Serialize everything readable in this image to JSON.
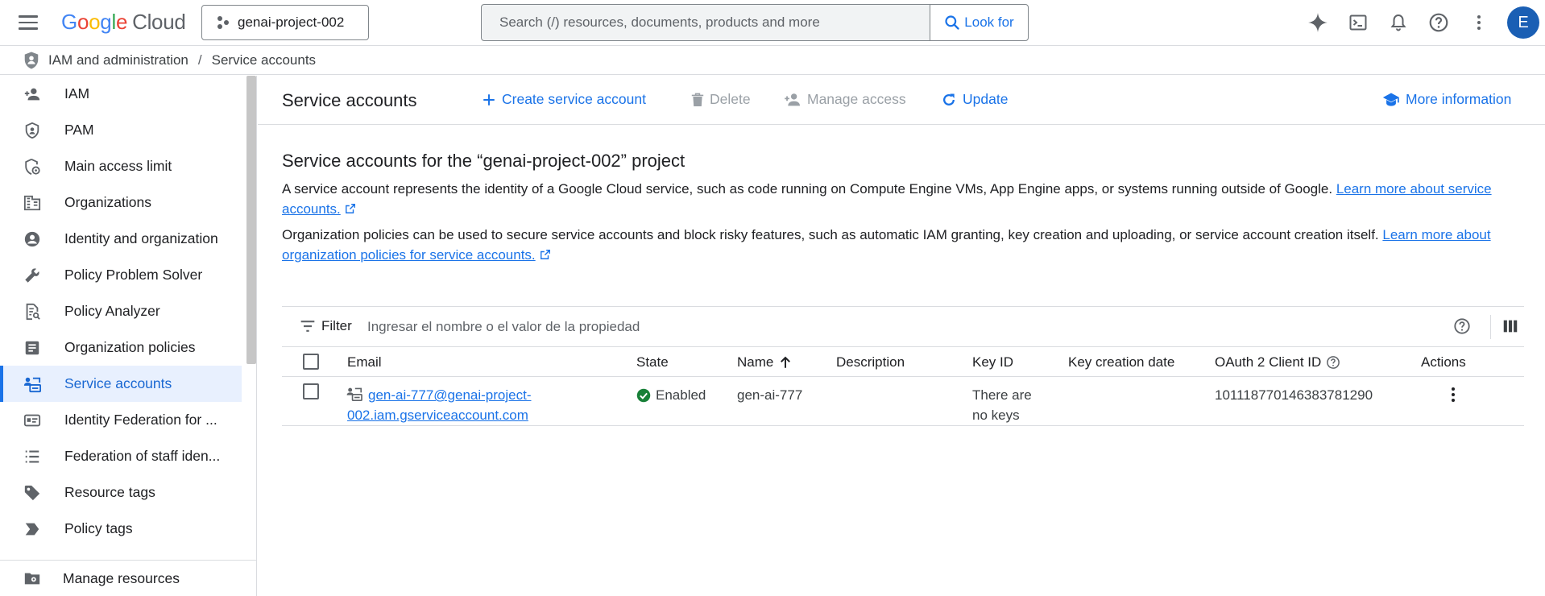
{
  "header": {
    "logo": {
      "g": "G",
      "o1": "o",
      "o2": "o",
      "g2": "g",
      "l": "l",
      "e": "e",
      "cloud": "Cloud"
    },
    "project_name": "genai-project-002",
    "search_placeholder": "Search (/) resources, documents, products and more",
    "search_button": "Look for",
    "avatar_initial": "E",
    "icons": [
      "gemini-icon",
      "cloud-shell-icon",
      "notifications-icon",
      "help-icon",
      "more-vert-icon"
    ]
  },
  "breadcrumb": {
    "section": "IAM and administration",
    "separator": "/",
    "current": "Service accounts"
  },
  "sidebar": {
    "items": [
      {
        "label": "IAM",
        "icon": "person-add-icon"
      },
      {
        "label": "PAM",
        "icon": "shield-icon"
      },
      {
        "label": "Main access limit",
        "icon": "shield-gear-icon"
      },
      {
        "label": "Organizations",
        "icon": "domain-icon"
      },
      {
        "label": "Identity and organization",
        "icon": "account-circle-icon"
      },
      {
        "label": "Policy Problem Solver",
        "icon": "wrench-icon"
      },
      {
        "label": "Policy Analyzer",
        "icon": "policy-doc-icon"
      },
      {
        "label": "Organization policies",
        "icon": "list-doc-icon"
      },
      {
        "label": "Service accounts",
        "icon": "service-account-icon",
        "active": true
      },
      {
        "label": "Identity Federation for ...",
        "icon": "badge-icon"
      },
      {
        "label": "Federation of staff iden...",
        "icon": "list-icon"
      },
      {
        "label": "Resource tags",
        "icon": "tag-icon"
      },
      {
        "label": "Policy tags",
        "icon": "label-icon"
      }
    ],
    "footer": {
      "label": "Manage resources",
      "icon": "folder-gear-icon"
    }
  },
  "toolbar": {
    "title": "Service accounts",
    "create": "Create service account",
    "delete": "Delete",
    "manage_access": "Manage access",
    "update": "Update",
    "more_info": "More information"
  },
  "content": {
    "section_title": "Service accounts for the “genai-project-002” project",
    "para1_text": "A service account represents the identity of a Google Cloud service, such as code running on Compute Engine VMs, App Engine apps, or systems running outside of Google. ",
    "para1_link": "Learn more about service accounts.",
    "para2_text": "Organization policies can be used to secure service accounts and block risky features, such as automatic IAM granting, key creation and uploading, or service account creation itself. ",
    "para2_link": "Learn more about organization policies for service accounts."
  },
  "table": {
    "filter_label": "Filter",
    "filter_placeholder": "Ingresar el nombre o el valor de la propiedad",
    "columns": {
      "email": "Email",
      "state": "State",
      "name": "Name",
      "description": "Description",
      "key_id": "Key ID",
      "key_creation_date": "Key creation date",
      "oauth_client_id": "OAuth 2 Client ID",
      "actions": "Actions"
    },
    "rows": [
      {
        "email_line1": "gen-ai-777@genai-project-",
        "email_line2": "002.iam.gserviceaccount.com",
        "state": "Enabled",
        "name": "gen-ai-777",
        "description": "",
        "key_id_line1": "There are",
        "key_id_line2": "no keys",
        "key_creation_date": "",
        "oauth_client_id": "101118770146383781290"
      }
    ]
  },
  "colors": {
    "accent": "#1a73e8",
    "active_bg": "#e8f0fe",
    "success": "#188038",
    "disabled": "#9aa0a6"
  }
}
